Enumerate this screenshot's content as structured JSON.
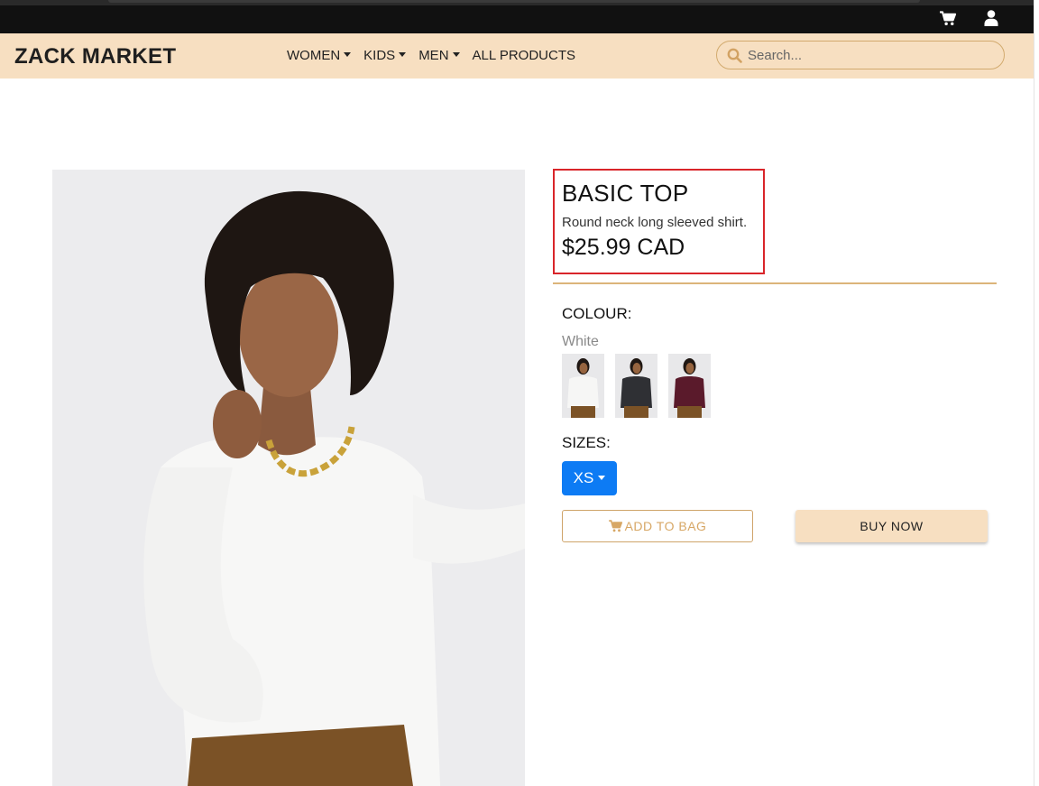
{
  "header": {
    "cart_icon": "cart-icon",
    "user_icon": "user-icon"
  },
  "navbar": {
    "brand": "ZACK MARKET",
    "links": [
      {
        "label": "WOMEN",
        "dropdown": true
      },
      {
        "label": "KIDS",
        "dropdown": true
      },
      {
        "label": "MEN",
        "dropdown": true
      },
      {
        "label": "ALL PRODUCTS",
        "dropdown": false
      }
    ],
    "search": {
      "placeholder": "Search...",
      "value": ""
    }
  },
  "product": {
    "title": "BASIC TOP",
    "description": "Round neck long sleeved shirt.",
    "price": "$25.99 CAD",
    "colour_label": "COLOUR:",
    "selected_colour": "White",
    "swatch_colors": [
      "#f3f3f1",
      "#2f3034",
      "#5a1a2b"
    ],
    "sizes_label": "SIZES:",
    "selected_size": "XS",
    "add_to_bag_label": "ADD TO BAG",
    "buy_now_label": "BUY NOW"
  },
  "colors": {
    "nav_bg": "#f7dfc1",
    "accent": "#d7a765",
    "primary_button": "#0d7bf4",
    "highlight_box": "#d9252a"
  }
}
